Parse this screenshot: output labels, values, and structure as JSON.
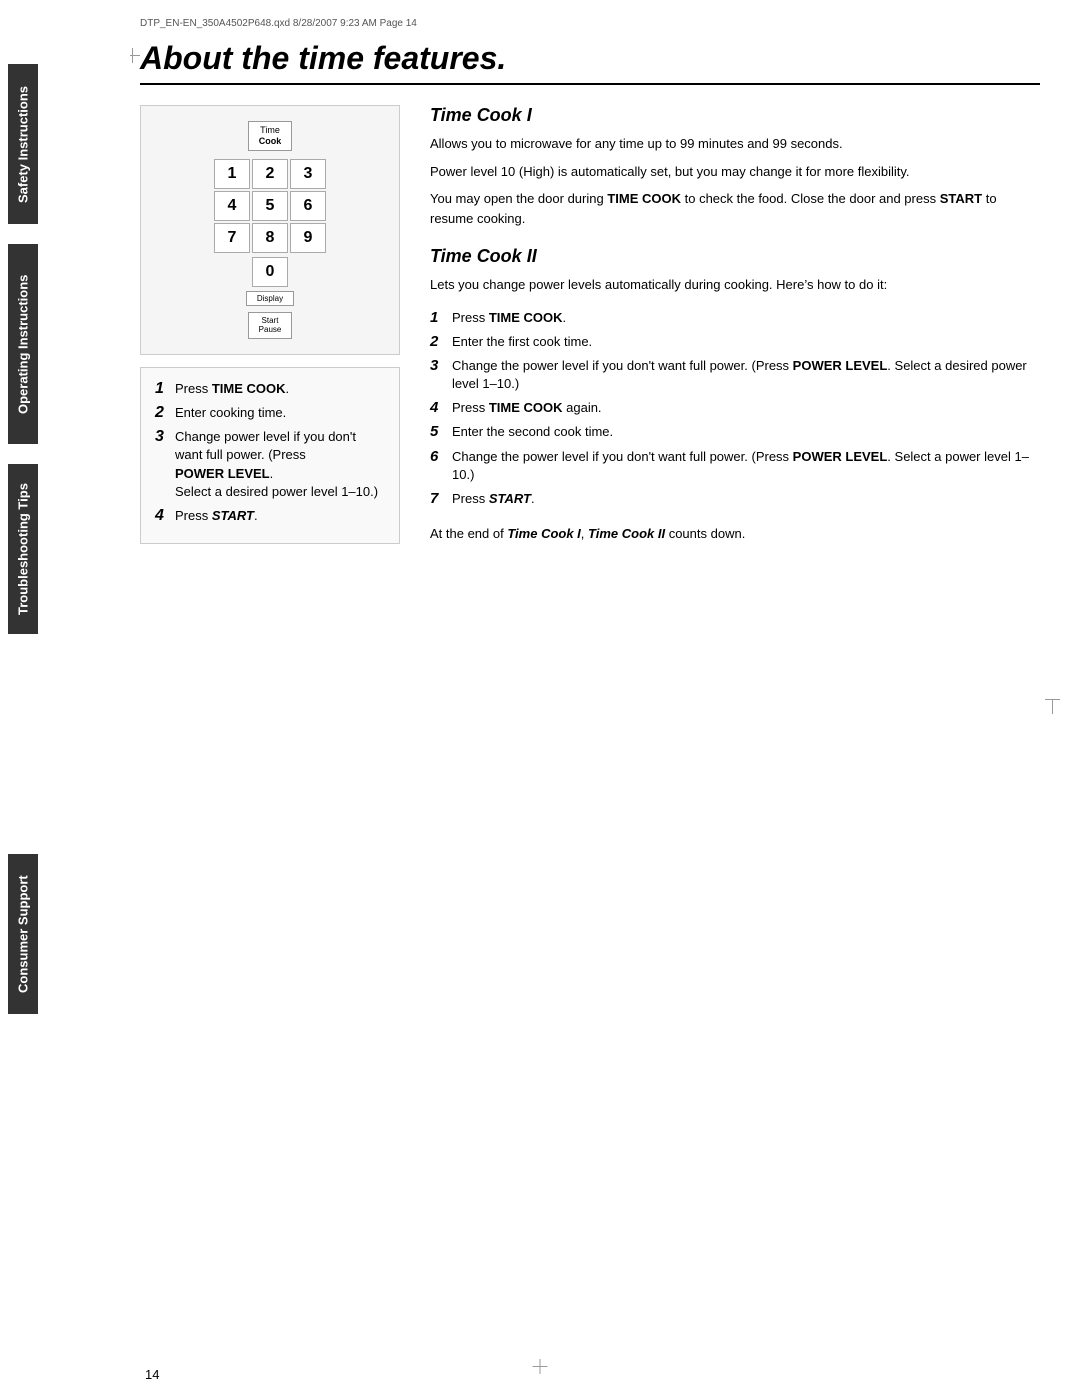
{
  "header": {
    "file_info": "DTP_EN-EN_350A4502P648.qxd   8/28/2007   9:23 AM   Page 14"
  },
  "sidebar": {
    "tabs": [
      {
        "id": "safety",
        "label": "Safety Instructions"
      },
      {
        "id": "operating",
        "label": "Operating Instructions"
      },
      {
        "id": "troubleshooting",
        "label": "Troubleshooting Tips"
      },
      {
        "id": "consumer",
        "label": "Consumer Support"
      }
    ]
  },
  "page": {
    "title": "About the time features.",
    "page_number": "14"
  },
  "keypad": {
    "label_line1": "Time",
    "label_line2": "Cook",
    "keys": [
      "1",
      "2",
      "3",
      "4",
      "5",
      "6",
      "7",
      "8",
      "9",
      "0"
    ],
    "display_label": "Display",
    "start_pause_line1": "Start",
    "start_pause_line2": "Pause"
  },
  "time_cook_1": {
    "title": "Time Cook I",
    "para1": "Allows you to microwave for any time up to 99 minutes and 99 seconds.",
    "para2": "Power level 10 (High) is automatically set, but you may change it for more flexibility.",
    "para3_prefix": "You may open the door during ",
    "para3_bold": "TIME COOK",
    "para3_mid": " to check the food. Close the door and press ",
    "para3_bold2": "START",
    "para3_end": " to resume cooking.",
    "steps": [
      {
        "num": "1",
        "text_prefix": "Press ",
        "text_bold": "TIME COOK",
        "text_end": "."
      },
      {
        "num": "2",
        "text": "Enter cooking time."
      },
      {
        "num": "3",
        "text": "Change power level if you don’t want full power. (Press ",
        "text_bold": "POWER LEVEL",
        "text_end": ". Select a desired power level 1–10.)"
      },
      {
        "num": "4",
        "text_prefix": "Press ",
        "text_bold": "START",
        "text_end": "."
      }
    ]
  },
  "time_cook_2": {
    "title": "Time Cook II",
    "para1": "Lets you change power levels automatically during cooking. Here’s how to do it:",
    "steps": [
      {
        "num": "1",
        "text_prefix": "Press ",
        "text_bold": "TIME COOK",
        "text_end": "."
      },
      {
        "num": "2",
        "text": "Enter the first cook time."
      },
      {
        "num": "3",
        "text": "Change the power level if you don’t want full power. (Press ",
        "text_bold": "POWER LEVEL",
        "text_end": ". Select a desired power level 1–10.)"
      },
      {
        "num": "4",
        "text_prefix": "Press ",
        "text_bold": "TIME COOK",
        "text_mid": " again.",
        "text_end": ""
      },
      {
        "num": "5",
        "text": "Enter the second cook time."
      },
      {
        "num": "6",
        "text": "Change the power level if you don’t want full power. (Press ",
        "text_bold": "POWER LEVEL",
        "text_end": ". Select a power level 1–10.)"
      },
      {
        "num": "7",
        "text_prefix": "Press ",
        "text_bold": "START",
        "text_end": "."
      }
    ],
    "footer_note_prefix": "At the end of ",
    "footer_bold1": "Time Cook I",
    "footer_mid": ", ",
    "footer_bold2": "Time Cook II",
    "footer_end": " counts down."
  }
}
